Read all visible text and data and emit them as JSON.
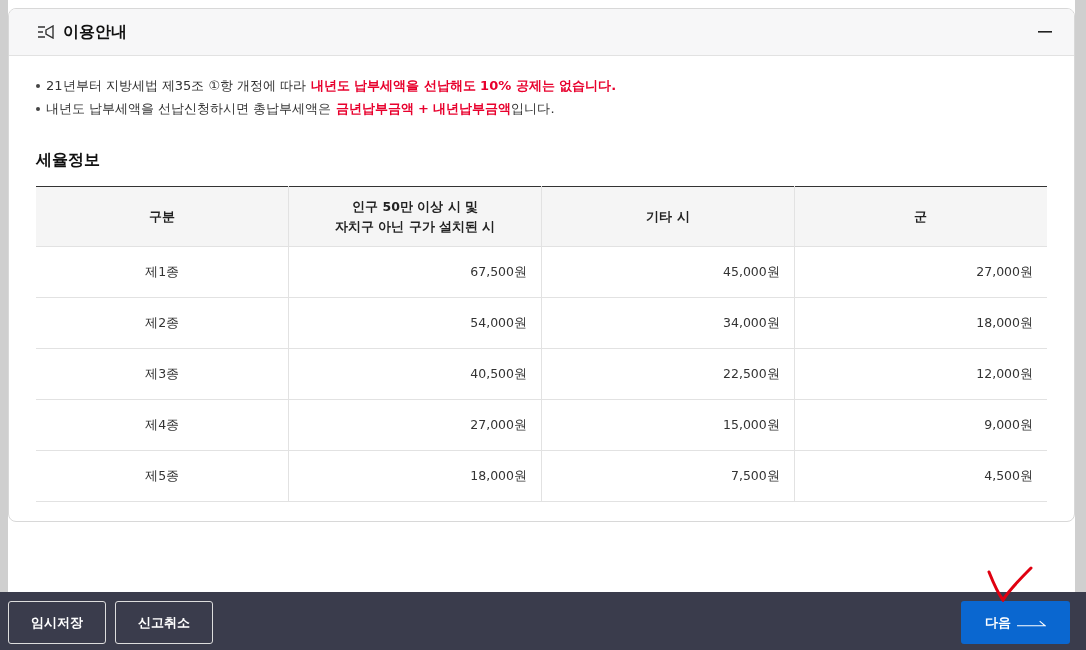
{
  "guide": {
    "title": "이용안내",
    "expanded": true,
    "notices": [
      "21년부터 지방세법 제35조 ①항 개정에 따라 **내년도 납부세액을 선납해도 10% 공제는 없습니다.**",
      "내년도 납부세액을 선납신청하시면 총납부세액은 **금년납부금액 + 내년납부금액**입니다."
    ],
    "section_title": "세율정보",
    "table": {
      "columns": [
        "구분",
        "인구 50만 이상 시 및\n자치구 아닌 구가 설치된 시",
        "기타 시",
        "군"
      ],
      "rows": [
        [
          "제1종",
          "67,500원",
          "45,000원",
          "27,000원"
        ],
        [
          "제2종",
          "54,000원",
          "34,000원",
          "18,000원"
        ],
        [
          "제3종",
          "40,500원",
          "22,500원",
          "12,000원"
        ],
        [
          "제4종",
          "27,000원",
          "15,000원",
          "9,000원"
        ],
        [
          "제5종",
          "18,000원",
          "7,500원",
          "4,500원"
        ]
      ]
    }
  },
  "footer": {
    "buttons": [
      {
        "label": "임시저장",
        "kind": "outline"
      },
      {
        "label": "신고취소",
        "kind": "outline"
      },
      {
        "label": "다음",
        "kind": "primary"
      }
    ]
  }
}
